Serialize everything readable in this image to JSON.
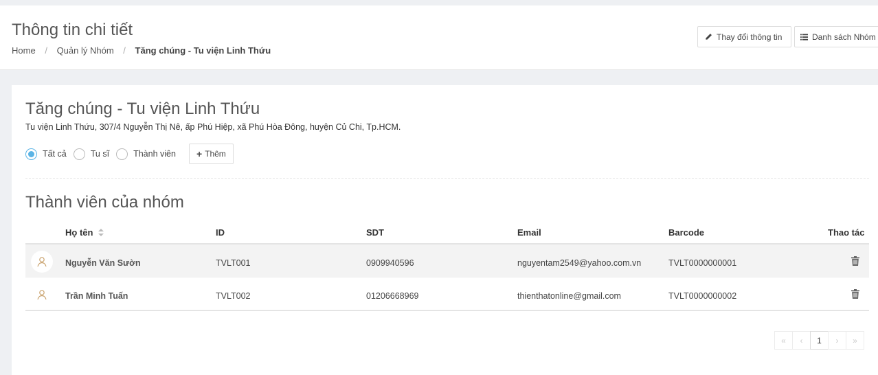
{
  "header": {
    "title": "Thông tin chi tiết",
    "breadcrumb": [
      "Home",
      "Quản lý Nhóm",
      "Tăng chúng - Tu viện Linh Thứu"
    ],
    "buttons": {
      "edit": "Thay đổi thông tin",
      "list": "Danh sách Nhóm"
    }
  },
  "group": {
    "name": "Tăng chúng - Tu viện Linh Thứu",
    "address": "Tu viện Linh Thứu, 307/4 Nguyễn Thị Nê, ấp Phú Hiệp, xã Phú Hòa Đông, huyện Củ Chi, Tp.HCM.",
    "filters": [
      {
        "label": "Tất cả",
        "checked": true
      },
      {
        "label": "Tu sĩ",
        "checked": false
      },
      {
        "label": "Thành viên",
        "checked": false
      }
    ],
    "add_label": "Thêm"
  },
  "members": {
    "title": "Thành viên của nhóm",
    "columns": [
      "Họ tên",
      "ID",
      "SDT",
      "Email",
      "Barcode",
      "Thao tác"
    ],
    "rows": [
      {
        "name": "Nguyễn Văn Sườn",
        "id": "TVLT001",
        "phone": "0909940596",
        "email": "nguyentam2549@yahoo.com.vn",
        "barcode": "TVLT0000000001"
      },
      {
        "name": "Trần Minh Tuấn",
        "id": "TVLT002",
        "phone": "01206668969",
        "email": "thienthatonline@gmail.com",
        "barcode": "TVLT0000000002"
      }
    ]
  },
  "pagination": {
    "current": "1"
  },
  "colors": {
    "accent": "#5bb4e5",
    "avatar": "#c8a06a"
  }
}
